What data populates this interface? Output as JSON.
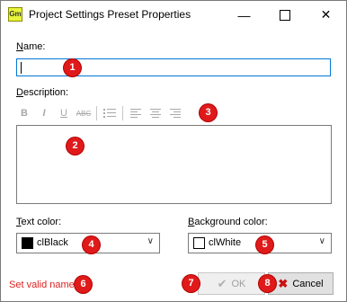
{
  "window": {
    "title": "Project Settings Preset Properties",
    "app_icon_text": "Gm",
    "minimize_glyph": "—",
    "close_glyph": "✕"
  },
  "name_field": {
    "label_underlined": "N",
    "label_rest": "ame:",
    "value": ""
  },
  "description": {
    "label_underlined": "D",
    "label_rest": "escription:",
    "value": ""
  },
  "toolbar": {
    "items": [
      {
        "name": "bold-button",
        "glyph": "B"
      },
      {
        "name": "italic-button",
        "glyph": "I"
      },
      {
        "name": "underline-button",
        "glyph": "U"
      },
      {
        "name": "strikethrough-button",
        "glyph": "ABC"
      },
      {
        "name": "bullet-list-button",
        "glyph": "list-icon"
      },
      {
        "name": "align-left-button",
        "glyph": "align-left-icon"
      },
      {
        "name": "align-center-button",
        "glyph": "align-center-icon"
      },
      {
        "name": "align-right-button",
        "glyph": "align-right-icon"
      }
    ]
  },
  "text_color": {
    "label_underlined": "T",
    "label_rest": "ext color:",
    "value": "clBlack",
    "swatch": "#000000"
  },
  "background_color": {
    "label_underlined": "B",
    "label_rest": "ackground color:",
    "value": "clWhite",
    "swatch": "#ffffff"
  },
  "status_text": "Set valid name",
  "buttons": {
    "ok": "OK",
    "cancel": "Cancel"
  },
  "badges": [
    "1",
    "2",
    "3",
    "4",
    "5",
    "6",
    "7",
    "8"
  ],
  "colors": {
    "accent": "#0078d7",
    "error": "#e02020",
    "badge": "#e01a1a"
  }
}
